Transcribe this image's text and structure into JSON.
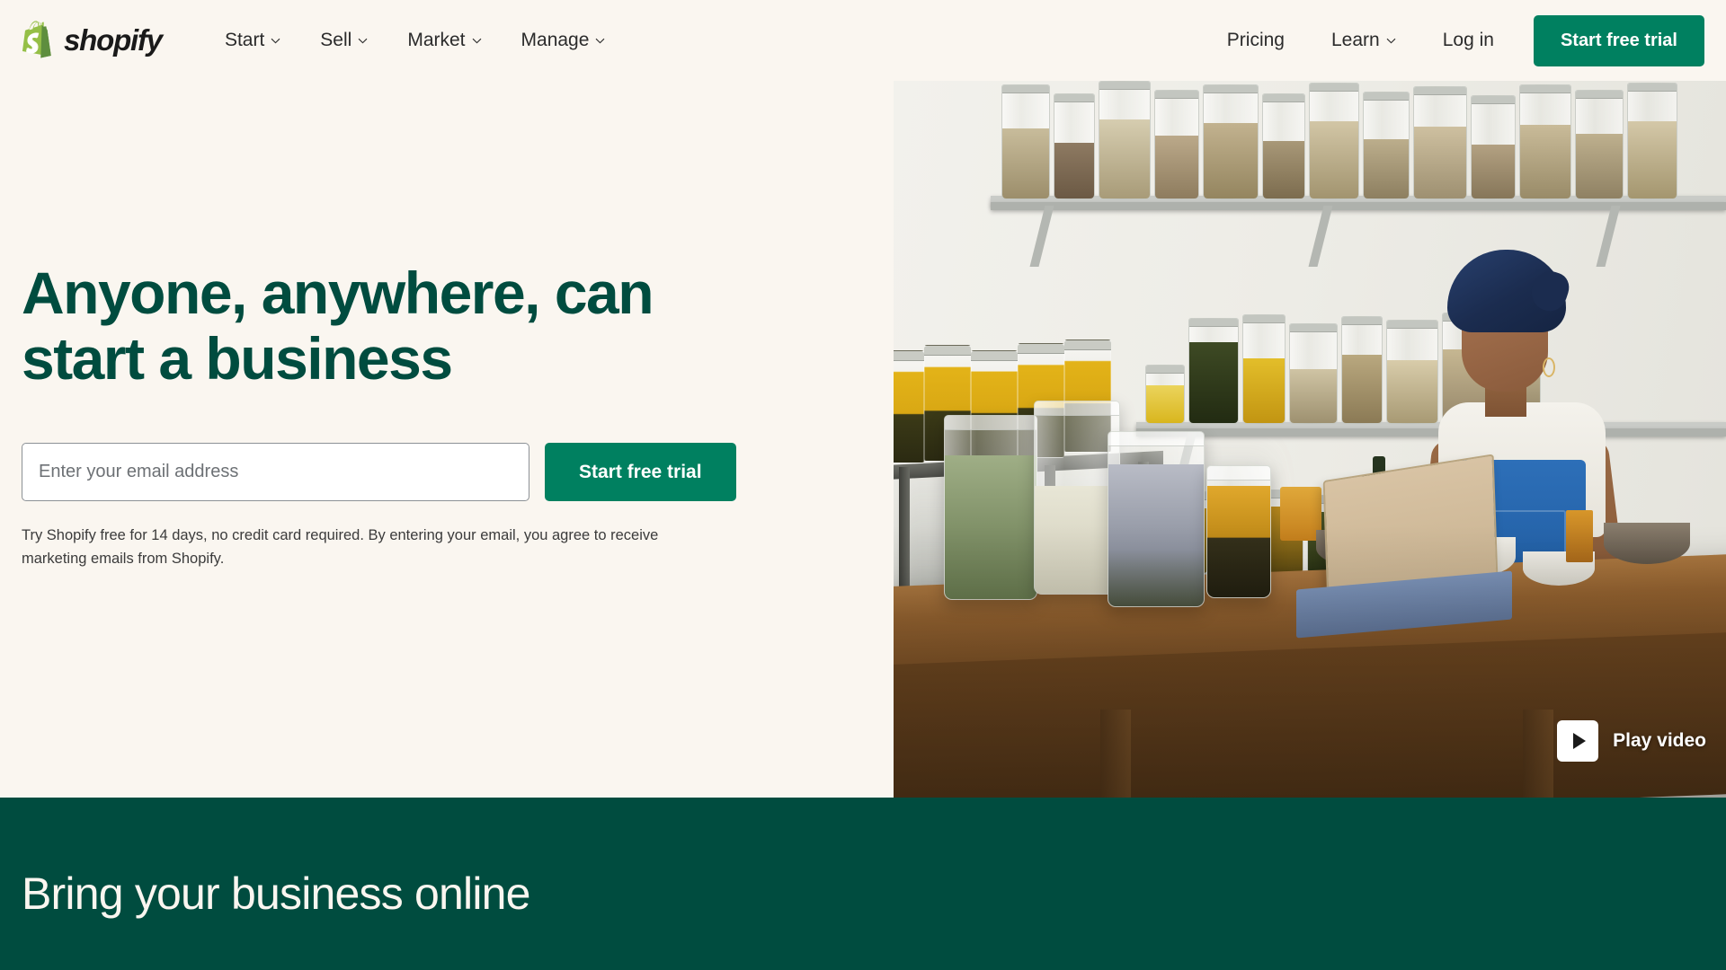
{
  "brand": {
    "name": "shopify",
    "logo_icon": "shopify-bag-icon",
    "logo_color": "#95BF47",
    "accent_green": "#008060",
    "dark_green": "#004C3F",
    "cream": "#FAF6F0"
  },
  "nav": {
    "primary_items": [
      {
        "label": "Start",
        "has_dropdown": true
      },
      {
        "label": "Sell",
        "has_dropdown": true
      },
      {
        "label": "Market",
        "has_dropdown": true
      },
      {
        "label": "Manage",
        "has_dropdown": true
      }
    ],
    "secondary_items": [
      {
        "label": "Pricing",
        "has_dropdown": false
      },
      {
        "label": "Learn",
        "has_dropdown": true
      },
      {
        "label": "Log in",
        "has_dropdown": false
      }
    ],
    "cta_label": "Start free trial"
  },
  "hero": {
    "title_line1": "Anyone, anywhere, can",
    "title_line2": "start a business",
    "email_placeholder": "Enter your email address",
    "email_value": "",
    "cta_label": "Start free trial",
    "legal": "Try Shopify free for 14 days, no credit card required. By entering your email, you agree to receive marketing emails from Shopify.",
    "play_label": "Play video",
    "play_icon": "play-triangle-icon",
    "image_alt": "Shop owner in a blue head wrap and denim apron working on a laptop at a wooden table surrounded by glass jars of herbs, grains and oils"
  },
  "section_green": {
    "title": "Bring your business online"
  }
}
